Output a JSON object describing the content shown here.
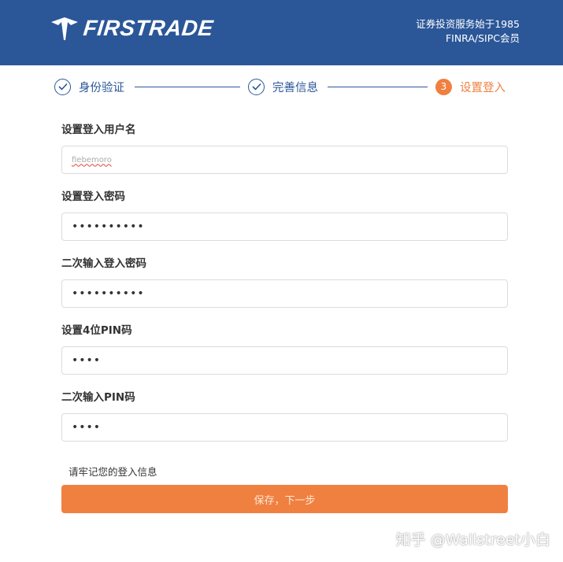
{
  "header": {
    "brand": "FIRSTRADE",
    "tagline_line1": "证券投资服务始于1985",
    "tagline_line2": "FINRA/SIPC会员",
    "bg_color": "#2b5799"
  },
  "steps": [
    {
      "label": "身份验证",
      "status": "done",
      "icon": "check-circle-icon"
    },
    {
      "label": "完善信息",
      "status": "done",
      "icon": "check-circle-icon"
    },
    {
      "label": "设置登入",
      "status": "active",
      "number": "3"
    }
  ],
  "form": {
    "username": {
      "label": "设置登入用户名",
      "value": "fiebemoro"
    },
    "password": {
      "label": "设置登入密码",
      "value": "••••••••••"
    },
    "password_confirm": {
      "label": "二次输入登入密码",
      "value": "••••••••••"
    },
    "pin": {
      "label": "设置4位PIN码",
      "value": "••••"
    },
    "pin_confirm": {
      "label": "二次输入PIN码",
      "value": "••••"
    }
  },
  "notice": "请牢记您的登入信息",
  "submit_label": "保存，下一步",
  "accent_color": "#f08040",
  "watermark": "知乎 @Wallstreet小白"
}
